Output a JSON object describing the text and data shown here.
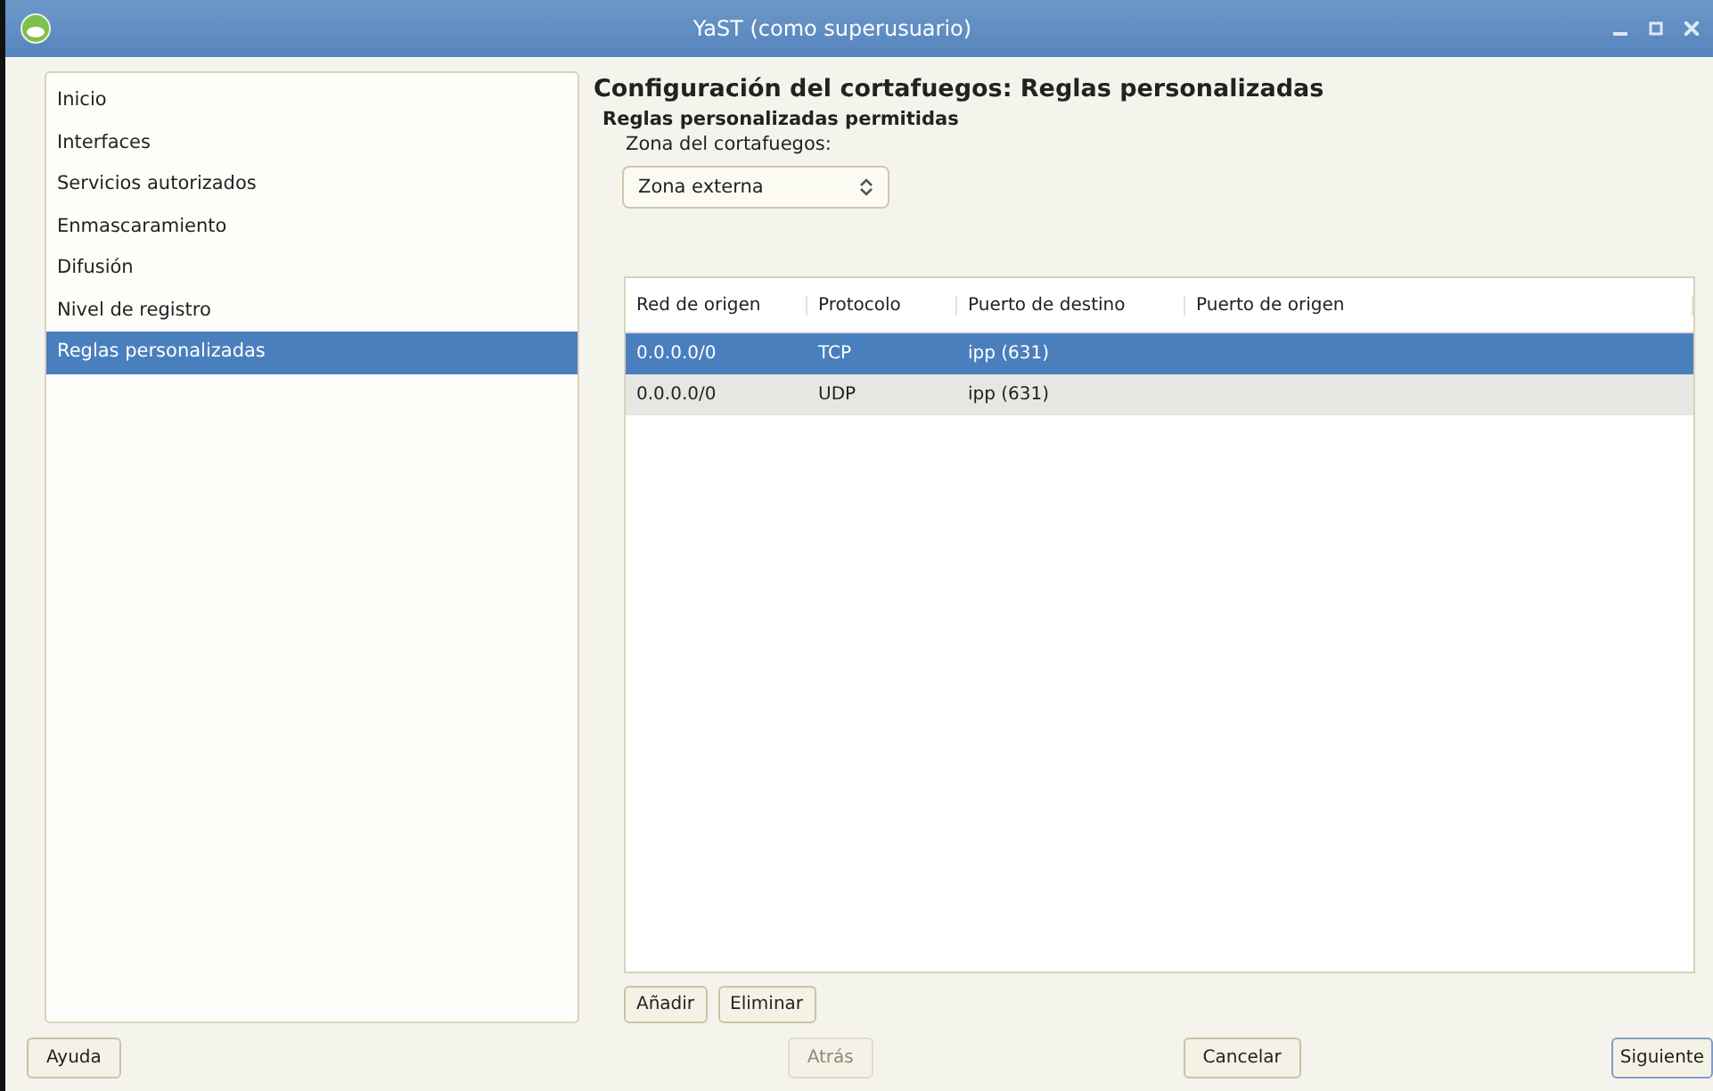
{
  "window": {
    "title": "YaST (como superusuario)"
  },
  "sidebar": {
    "items": [
      {
        "label": "Inicio",
        "selected": false
      },
      {
        "label": "Interfaces",
        "selected": false
      },
      {
        "label": "Servicios autorizados",
        "selected": false
      },
      {
        "label": "Enmascaramiento",
        "selected": false
      },
      {
        "label": "Difusión",
        "selected": false
      },
      {
        "label": "Nivel de registro",
        "selected": false
      },
      {
        "label": "Reglas personalizadas",
        "selected": true
      }
    ]
  },
  "heading": "Configuración del cortafuegos: Reglas personalizadas",
  "subheading": "Reglas personalizadas permitidas",
  "zone": {
    "label": "Zona del cortafuegos:",
    "value": "Zona externa"
  },
  "table": {
    "columns": [
      "Red de origen",
      "Protocolo",
      "Puerto de destino",
      "Puerto de origen"
    ],
    "rows": [
      {
        "cells": [
          "0.0.0.0/0",
          "TCP",
          "ipp (631)",
          ""
        ],
        "selected": true
      },
      {
        "cells": [
          "0.0.0.0/0",
          "UDP",
          "ipp (631)",
          ""
        ],
        "selected": false
      }
    ]
  },
  "table_buttons": [
    {
      "label": "Añadir",
      "disabled": false
    },
    {
      "label": "Eliminar",
      "disabled": false
    }
  ],
  "footer_buttons": [
    {
      "label": "Ayuda",
      "disabled": false
    },
    {
      "label": "Atrás",
      "disabled": true
    },
    {
      "label": "Cancelar",
      "disabled": false
    },
    {
      "label": "Siguiente",
      "disabled": false
    }
  ]
}
